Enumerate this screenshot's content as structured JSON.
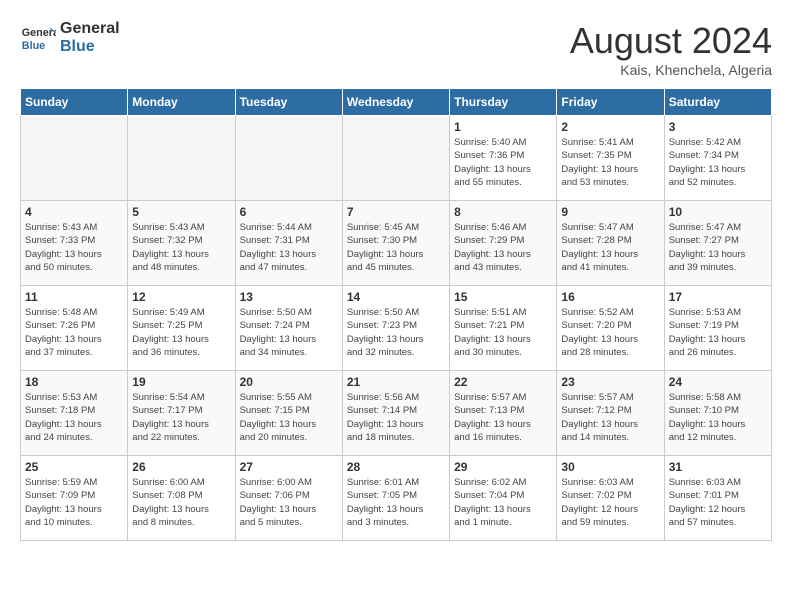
{
  "header": {
    "logo_general": "General",
    "logo_blue": "Blue",
    "month_title": "August 2024",
    "location": "Kais, Khenchela, Algeria"
  },
  "days_of_week": [
    "Sunday",
    "Monday",
    "Tuesday",
    "Wednesday",
    "Thursday",
    "Friday",
    "Saturday"
  ],
  "weeks": [
    [
      {
        "day": "",
        "info": ""
      },
      {
        "day": "",
        "info": ""
      },
      {
        "day": "",
        "info": ""
      },
      {
        "day": "",
        "info": ""
      },
      {
        "day": "1",
        "info": "Sunrise: 5:40 AM\nSunset: 7:36 PM\nDaylight: 13 hours\nand 55 minutes."
      },
      {
        "day": "2",
        "info": "Sunrise: 5:41 AM\nSunset: 7:35 PM\nDaylight: 13 hours\nand 53 minutes."
      },
      {
        "day": "3",
        "info": "Sunrise: 5:42 AM\nSunset: 7:34 PM\nDaylight: 13 hours\nand 52 minutes."
      }
    ],
    [
      {
        "day": "4",
        "info": "Sunrise: 5:43 AM\nSunset: 7:33 PM\nDaylight: 13 hours\nand 50 minutes."
      },
      {
        "day": "5",
        "info": "Sunrise: 5:43 AM\nSunset: 7:32 PM\nDaylight: 13 hours\nand 48 minutes."
      },
      {
        "day": "6",
        "info": "Sunrise: 5:44 AM\nSunset: 7:31 PM\nDaylight: 13 hours\nand 47 minutes."
      },
      {
        "day": "7",
        "info": "Sunrise: 5:45 AM\nSunset: 7:30 PM\nDaylight: 13 hours\nand 45 minutes."
      },
      {
        "day": "8",
        "info": "Sunrise: 5:46 AM\nSunset: 7:29 PM\nDaylight: 13 hours\nand 43 minutes."
      },
      {
        "day": "9",
        "info": "Sunrise: 5:47 AM\nSunset: 7:28 PM\nDaylight: 13 hours\nand 41 minutes."
      },
      {
        "day": "10",
        "info": "Sunrise: 5:47 AM\nSunset: 7:27 PM\nDaylight: 13 hours\nand 39 minutes."
      }
    ],
    [
      {
        "day": "11",
        "info": "Sunrise: 5:48 AM\nSunset: 7:26 PM\nDaylight: 13 hours\nand 37 minutes."
      },
      {
        "day": "12",
        "info": "Sunrise: 5:49 AM\nSunset: 7:25 PM\nDaylight: 13 hours\nand 36 minutes."
      },
      {
        "day": "13",
        "info": "Sunrise: 5:50 AM\nSunset: 7:24 PM\nDaylight: 13 hours\nand 34 minutes."
      },
      {
        "day": "14",
        "info": "Sunrise: 5:50 AM\nSunset: 7:23 PM\nDaylight: 13 hours\nand 32 minutes."
      },
      {
        "day": "15",
        "info": "Sunrise: 5:51 AM\nSunset: 7:21 PM\nDaylight: 13 hours\nand 30 minutes."
      },
      {
        "day": "16",
        "info": "Sunrise: 5:52 AM\nSunset: 7:20 PM\nDaylight: 13 hours\nand 28 minutes."
      },
      {
        "day": "17",
        "info": "Sunrise: 5:53 AM\nSunset: 7:19 PM\nDaylight: 13 hours\nand 26 minutes."
      }
    ],
    [
      {
        "day": "18",
        "info": "Sunrise: 5:53 AM\nSunset: 7:18 PM\nDaylight: 13 hours\nand 24 minutes."
      },
      {
        "day": "19",
        "info": "Sunrise: 5:54 AM\nSunset: 7:17 PM\nDaylight: 13 hours\nand 22 minutes."
      },
      {
        "day": "20",
        "info": "Sunrise: 5:55 AM\nSunset: 7:15 PM\nDaylight: 13 hours\nand 20 minutes."
      },
      {
        "day": "21",
        "info": "Sunrise: 5:56 AM\nSunset: 7:14 PM\nDaylight: 13 hours\nand 18 minutes."
      },
      {
        "day": "22",
        "info": "Sunrise: 5:57 AM\nSunset: 7:13 PM\nDaylight: 13 hours\nand 16 minutes."
      },
      {
        "day": "23",
        "info": "Sunrise: 5:57 AM\nSunset: 7:12 PM\nDaylight: 13 hours\nand 14 minutes."
      },
      {
        "day": "24",
        "info": "Sunrise: 5:58 AM\nSunset: 7:10 PM\nDaylight: 13 hours\nand 12 minutes."
      }
    ],
    [
      {
        "day": "25",
        "info": "Sunrise: 5:59 AM\nSunset: 7:09 PM\nDaylight: 13 hours\nand 10 minutes."
      },
      {
        "day": "26",
        "info": "Sunrise: 6:00 AM\nSunset: 7:08 PM\nDaylight: 13 hours\nand 8 minutes."
      },
      {
        "day": "27",
        "info": "Sunrise: 6:00 AM\nSunset: 7:06 PM\nDaylight: 13 hours\nand 5 minutes."
      },
      {
        "day": "28",
        "info": "Sunrise: 6:01 AM\nSunset: 7:05 PM\nDaylight: 13 hours\nand 3 minutes."
      },
      {
        "day": "29",
        "info": "Sunrise: 6:02 AM\nSunset: 7:04 PM\nDaylight: 13 hours\nand 1 minute."
      },
      {
        "day": "30",
        "info": "Sunrise: 6:03 AM\nSunset: 7:02 PM\nDaylight: 12 hours\nand 59 minutes."
      },
      {
        "day": "31",
        "info": "Sunrise: 6:03 AM\nSunset: 7:01 PM\nDaylight: 12 hours\nand 57 minutes."
      }
    ]
  ]
}
